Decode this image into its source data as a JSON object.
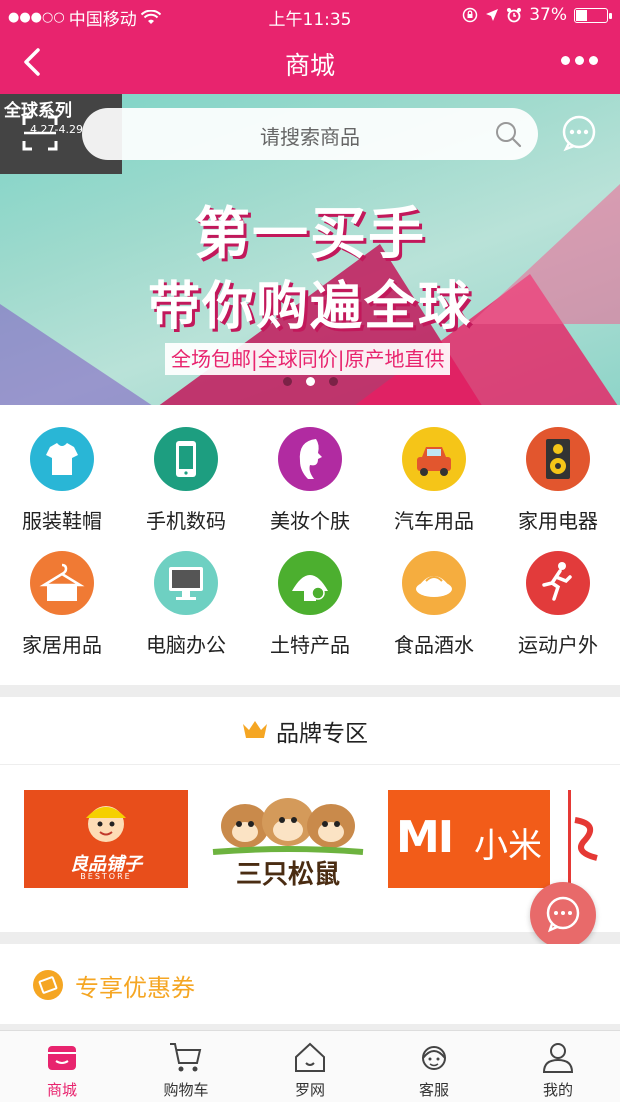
{
  "status_bar": {
    "carrier": "中国移动",
    "time": "上午11:35",
    "battery": "37%",
    "battery_level": 0.37
  },
  "navbar": {
    "title": "商城"
  },
  "search": {
    "placeholder": "请搜索商品"
  },
  "banner": {
    "promo_tag": "全球系列",
    "promo_dates": "4.27-4.29",
    "headline1": "第一买手",
    "headline2": "带你购遍全球",
    "subline": "全场包邮|全球同价|原产地直供",
    "slide_count": 3,
    "active_slide": 2
  },
  "categories": [
    {
      "label": "服装鞋帽",
      "icon": "tshirt-icon",
      "color": "#29b6d6"
    },
    {
      "label": "手机数码",
      "icon": "phone-icon",
      "color": "#1d9e80"
    },
    {
      "label": "美妆个肤",
      "icon": "woman-profile-icon",
      "color": "#b12ba1"
    },
    {
      "label": "汽车用品",
      "icon": "car-icon",
      "color": "#f5c518"
    },
    {
      "label": "家用电器",
      "icon": "speaker-icon",
      "color": "#e2562e"
    },
    {
      "label": "家居用品",
      "icon": "hanger-icon",
      "color": "#f07a34"
    },
    {
      "label": "电脑办公",
      "icon": "monitor-icon",
      "color": "#6ed0c2"
    },
    {
      "label": "土特产品",
      "icon": "local-specialty-icon",
      "color": "#4caf2f"
    },
    {
      "label": "食品酒水",
      "icon": "food-icon",
      "color": "#f5ad3f"
    },
    {
      "label": "运动户外",
      "icon": "runner-icon",
      "color": "#e23b3b"
    }
  ],
  "brand_section": {
    "title": "品牌专区",
    "brands": [
      {
        "name": "良品铺子",
        "sub": "BESTORE"
      },
      {
        "name": "三只松鼠"
      },
      {
        "name_en": "MI",
        "name": "小米"
      }
    ]
  },
  "coupon": {
    "title": "专享优惠券"
  },
  "tabbar": [
    {
      "label": "商城",
      "icon": "store-icon",
      "active": true
    },
    {
      "label": "购物车",
      "icon": "cart-icon",
      "active": false
    },
    {
      "label": "罗网",
      "icon": "home-icon",
      "active": false
    },
    {
      "label": "客服",
      "icon": "customer-service-icon",
      "active": false
    },
    {
      "label": "我的",
      "icon": "user-icon",
      "active": false
    }
  ],
  "colors": {
    "brand": "#e8246e",
    "coupon": "#f5a623"
  }
}
